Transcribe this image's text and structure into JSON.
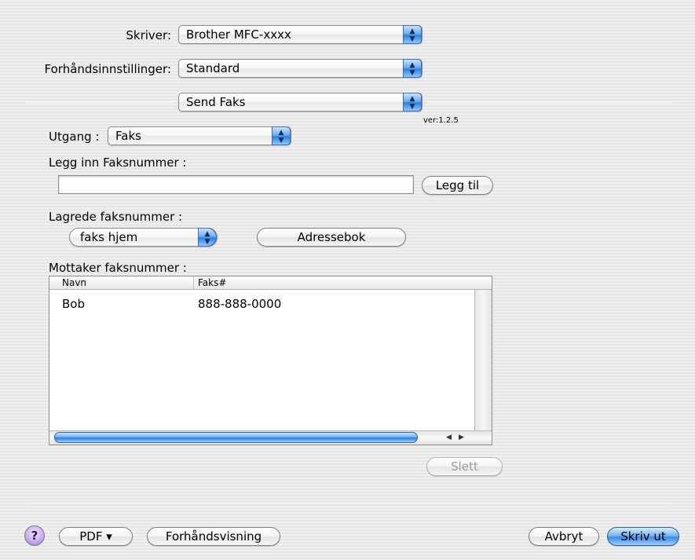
{
  "printer": {
    "label": "Skriver:",
    "value": "Brother MFC-xxxx"
  },
  "presets": {
    "label": "Forhåndsinnstillinger:",
    "value": "Standard"
  },
  "panel": {
    "value": "Send Faks"
  },
  "version": "ver:1.2.5",
  "output": {
    "label": "Utgang :",
    "value": "Faks"
  },
  "fax_entry": {
    "label": "Legg inn Faksnummer :",
    "value": "",
    "add_button": "Legg til"
  },
  "saved": {
    "label": "Lagrede faksnummer :",
    "value": "faks hjem",
    "addressbook_button": "Adressebok"
  },
  "recipients": {
    "label": "Mottaker faksnummer :",
    "columns": [
      "Navn",
      "Faks#"
    ],
    "rows": [
      {
        "name": "Bob",
        "fax": "888-888-0000"
      }
    ]
  },
  "delete_button": "Slett",
  "footer": {
    "help": "?",
    "pdf_button": "PDF ▾",
    "preview_button": "Forhåndsvisning",
    "cancel_button": "Avbryt",
    "print_button": "Skriv ut"
  },
  "icons": {
    "popup_arrows": "up-down-arrows-icon",
    "help": "question-mark-icon",
    "scroll_left": "scroll-left-icon",
    "scroll_right": "scroll-right-icon"
  },
  "colors": {
    "accent": "#3b8ae6",
    "help_purple": "#c7a7ec"
  }
}
